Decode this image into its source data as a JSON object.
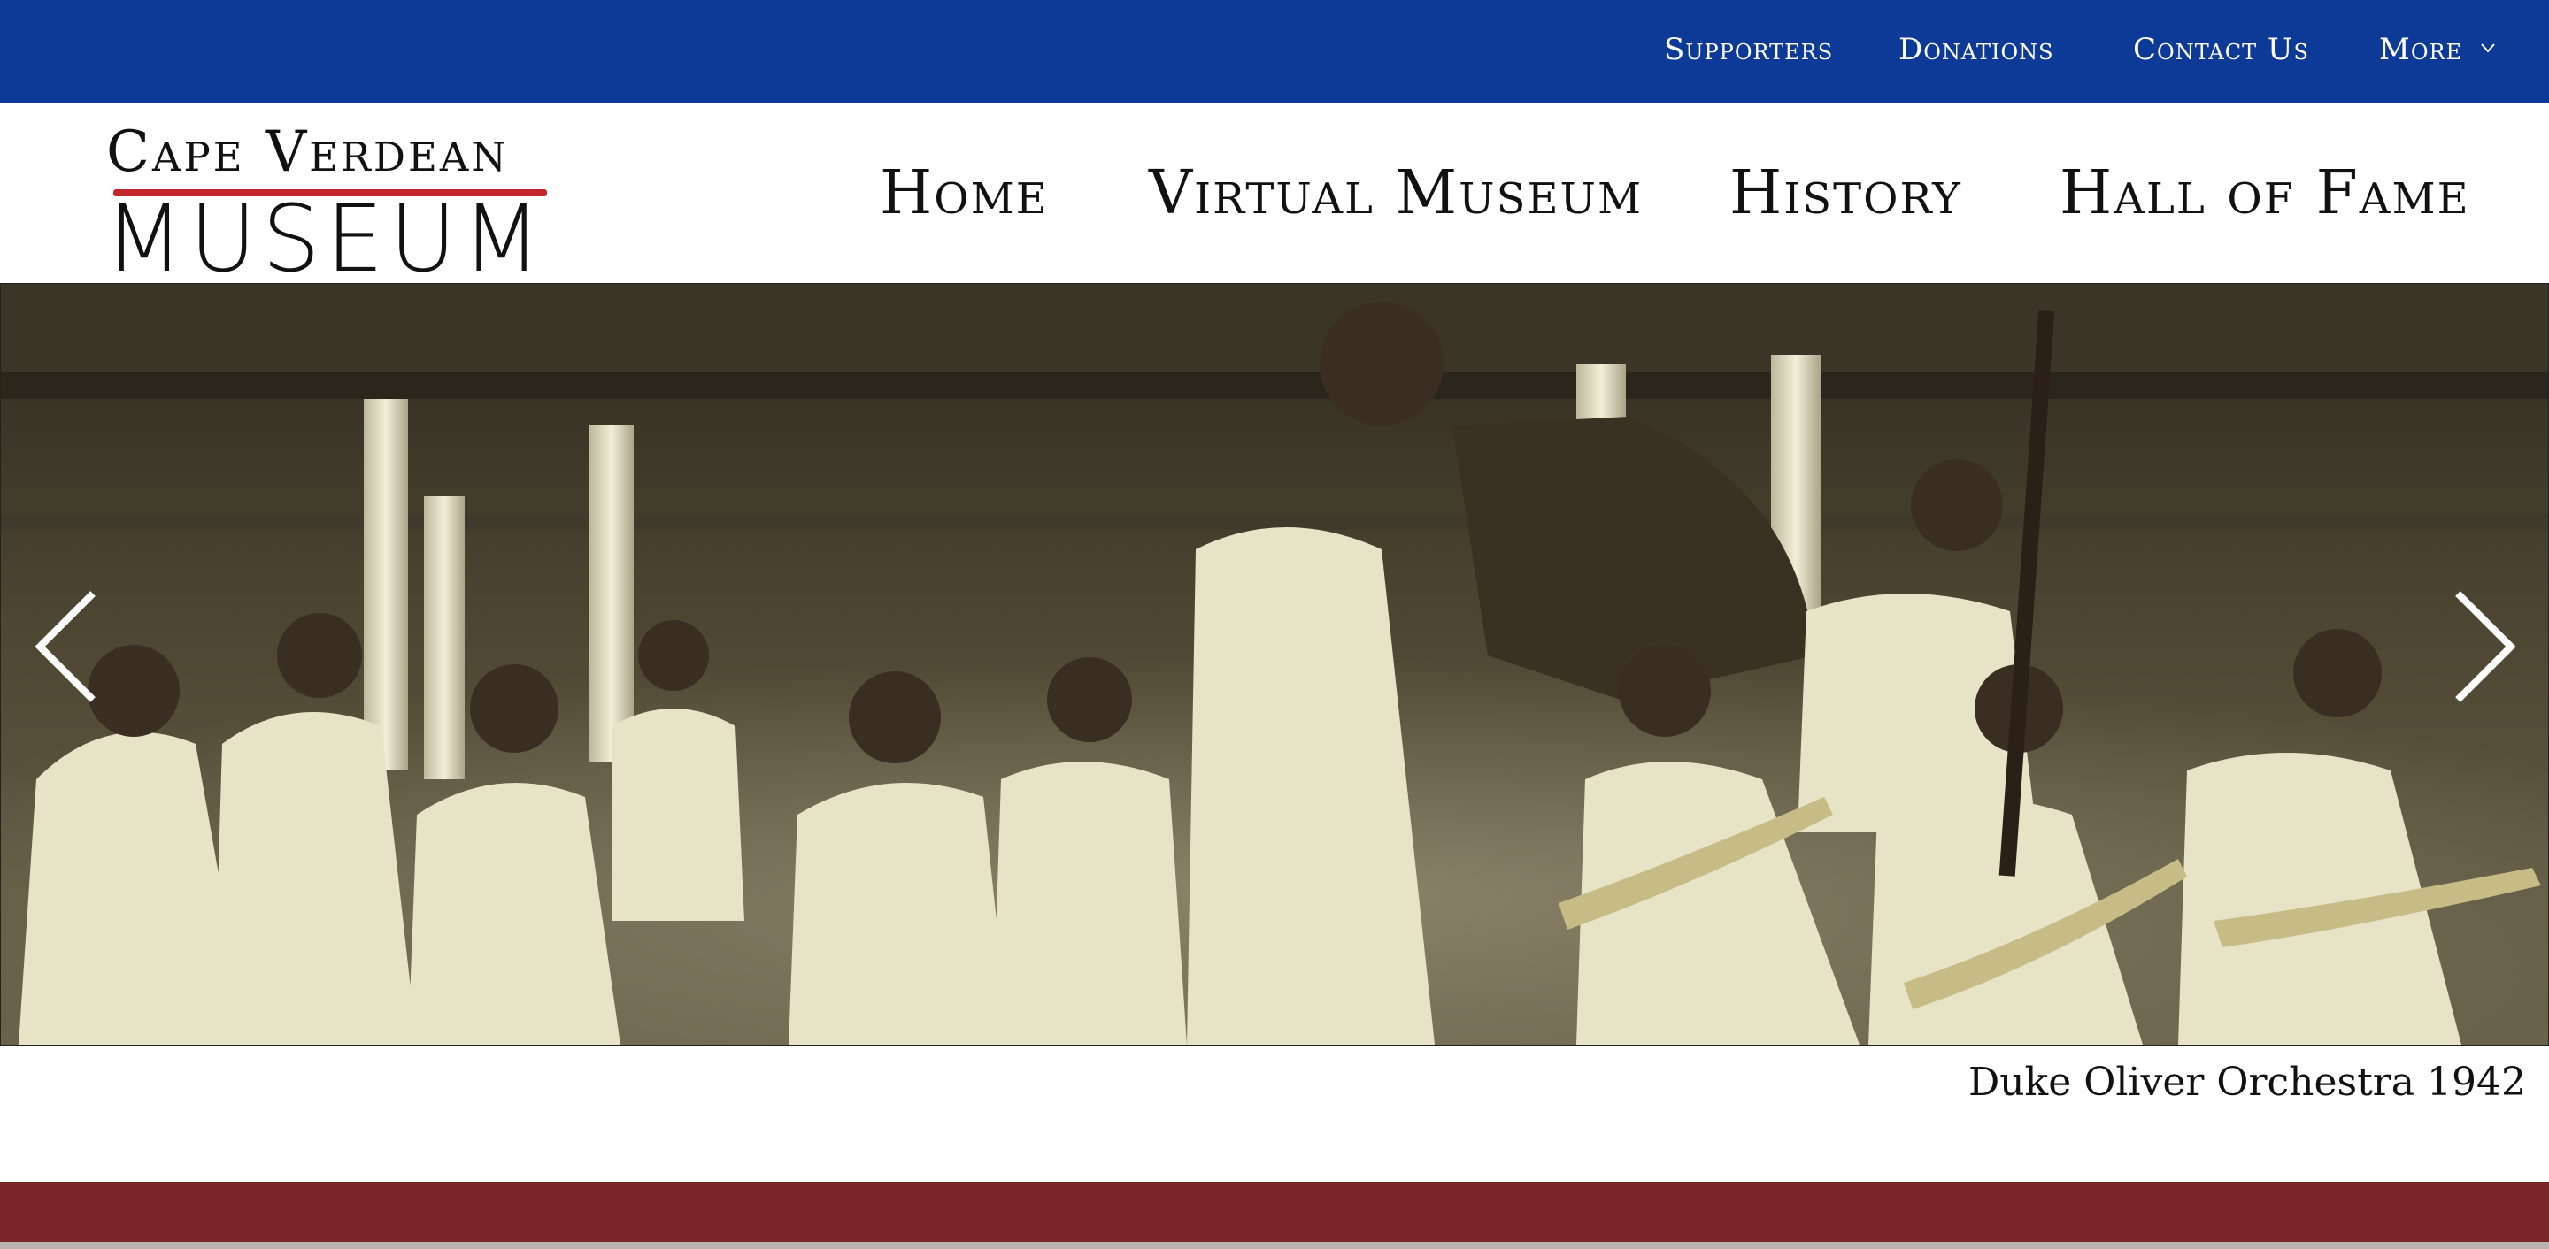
{
  "top_nav": {
    "items": [
      {
        "label": "Supporters"
      },
      {
        "label": "Donations"
      },
      {
        "label": "Contact Us"
      },
      {
        "label": "More"
      }
    ]
  },
  "logo": {
    "line1": "Cape Verdean",
    "line2": "MUSEUM"
  },
  "main_nav": {
    "items": [
      {
        "label": "Home"
      },
      {
        "label": "Virtual Museum"
      },
      {
        "label": "History"
      },
      {
        "label": "Hall of Fame"
      }
    ]
  },
  "hero": {
    "caption": "Duke Oliver Orchestra 1942"
  },
  "colors": {
    "topbar": "#0d3a96",
    "logo_rule": "#c1272d",
    "footer_band": "#7a2628"
  },
  "icons": {
    "more": "chevron-down-icon",
    "prev": "chevron-left-icon",
    "next": "chevron-right-icon"
  }
}
